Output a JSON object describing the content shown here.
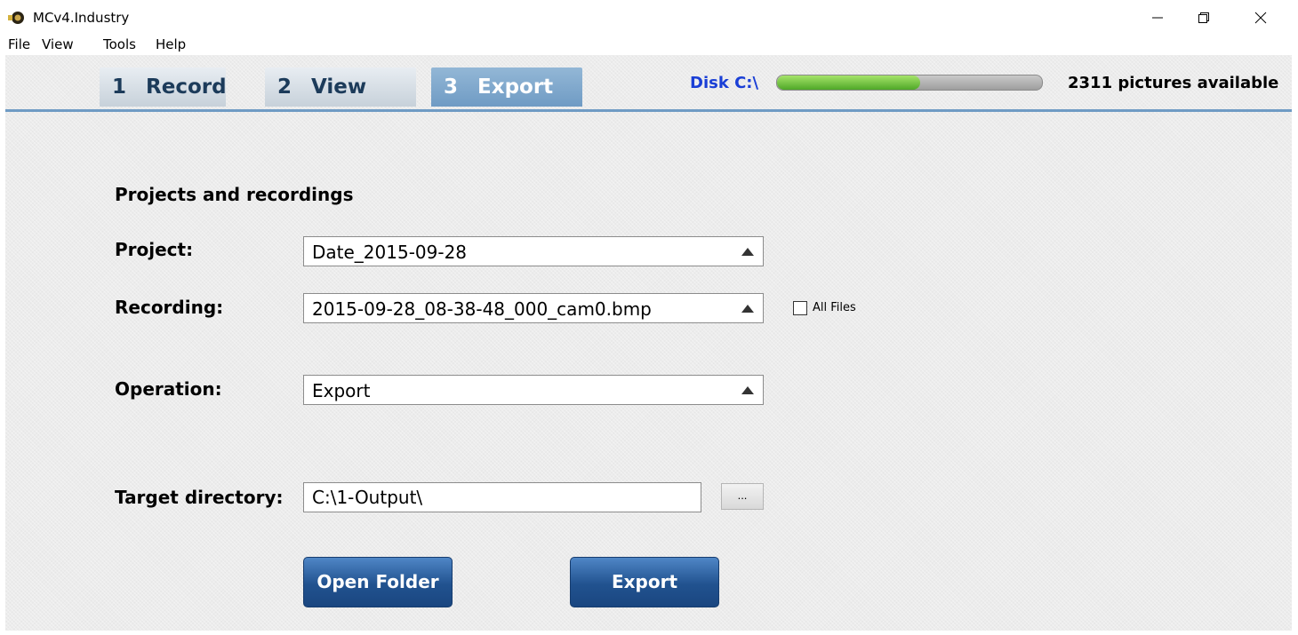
{
  "window": {
    "title": "MCv4.Industry",
    "icon": "app-camera-icon",
    "controls": [
      "minimize-icon",
      "restore-icon",
      "close-icon"
    ]
  },
  "menu": [
    "File",
    "View",
    "Tools",
    "Help"
  ],
  "tabs": [
    {
      "number": "1",
      "label": "Record",
      "active": false
    },
    {
      "number": "2",
      "label": "View",
      "active": false
    },
    {
      "number": "3",
      "label": "Export",
      "active": true
    }
  ],
  "disk": {
    "label": "Disk C:\\",
    "usage_fraction": 0.54,
    "pictures_available": "2311 pictures available"
  },
  "form": {
    "section_title": "Projects and recordings",
    "project_label": "Project:",
    "project_value": "Date_2015-09-28",
    "recording_label": "Recording:",
    "recording_value": "2015-09-28_08-38-48_000_cam0.bmp",
    "all_files_label": "All Files",
    "all_files_checked": false,
    "operation_label": "Operation:",
    "operation_value": "Export",
    "target_label": "Target directory:",
    "target_value": "C:\\1-Output\\",
    "browse_label": "..."
  },
  "buttons": {
    "open_folder": "Open Folder",
    "export": "Export"
  },
  "colors": {
    "accent_blue": "#21528f",
    "disk_label": "#1a3fd6",
    "disk_fill": "#4fa828",
    "tab_active": "#6f9bc4"
  }
}
